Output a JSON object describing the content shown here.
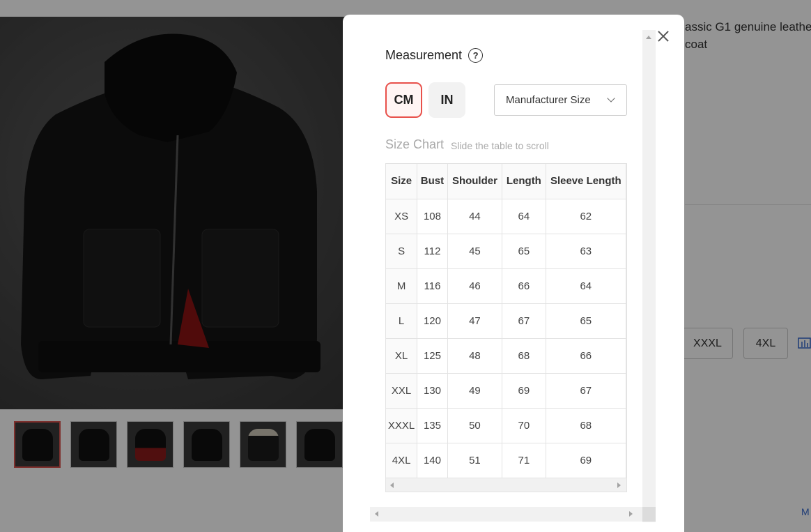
{
  "product": {
    "title_line1": "assic G1 genuine leathe",
    "title_line2": "coat",
    "size_buttons": [
      "XXXL",
      "4XL"
    ],
    "partial_link": "M"
  },
  "modal": {
    "title": "Measurement",
    "help_symbol": "?",
    "units": [
      "CM",
      "IN"
    ],
    "selected_unit": "CM",
    "size_select": "Manufacturer Size",
    "size_chart_label": "Size Chart",
    "size_chart_hint": "Slide the table to scroll",
    "table": {
      "headers": [
        "Size",
        "Bust",
        "Shoulder",
        "Length",
        "Sleeve Length"
      ],
      "rows": [
        [
          "XS",
          "108",
          "44",
          "64",
          "62"
        ],
        [
          "S",
          "112",
          "45",
          "65",
          "63"
        ],
        [
          "M",
          "116",
          "46",
          "66",
          "64"
        ],
        [
          "L",
          "120",
          "47",
          "67",
          "65"
        ],
        [
          "XL",
          "125",
          "48",
          "68",
          "66"
        ],
        [
          "XXL",
          "130",
          "49",
          "69",
          "67"
        ],
        [
          "XXXL",
          "135",
          "50",
          "70",
          "68"
        ],
        [
          "4XL",
          "140",
          "51",
          "71",
          "69"
        ]
      ]
    }
  },
  "colors": {
    "accent": "#e8504a",
    "overlay": "rgba(0,0,0,0.42)"
  }
}
